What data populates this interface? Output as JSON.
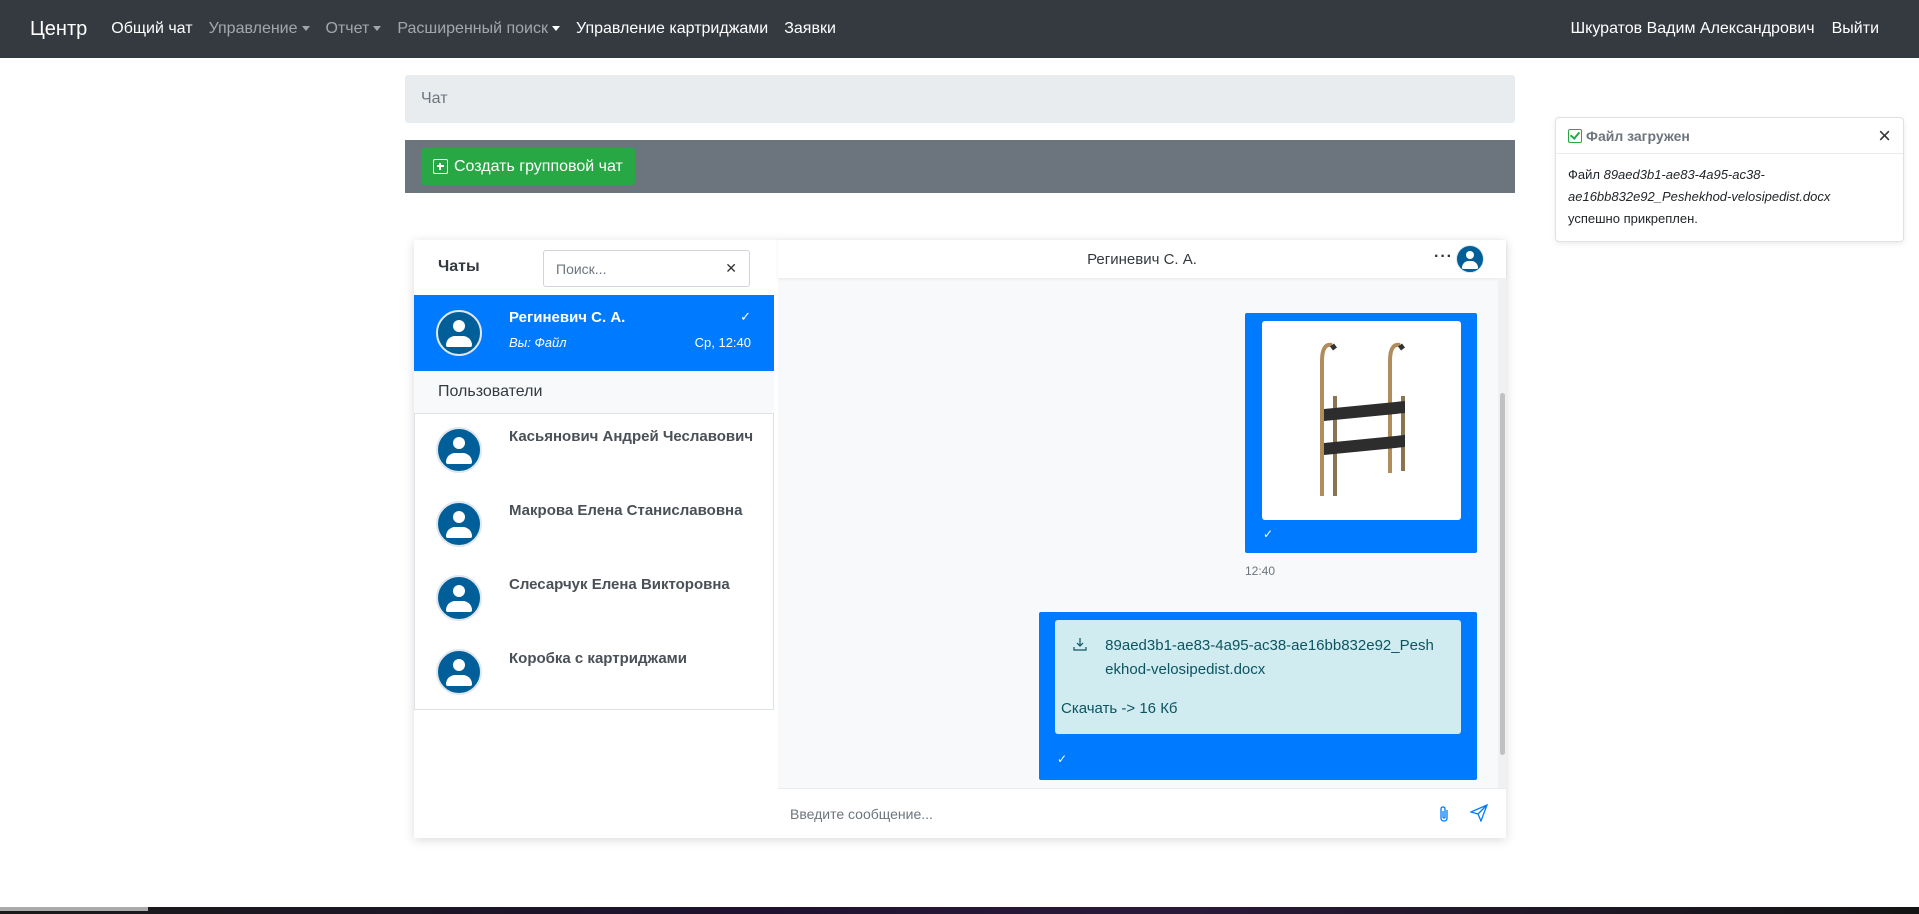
{
  "navbar": {
    "brand": "Центр",
    "links": [
      "Общий чат",
      "Управление",
      "Отчет",
      "Расширенный поиск",
      "Управление картриджами",
      "Заявки"
    ],
    "user_name": "Шкуратов Вадим Александрович",
    "logout": "Выйти"
  },
  "page": {
    "title": "Чат",
    "create_group_label": "Создать групповой чат"
  },
  "toast": {
    "title": "Файл загружен",
    "body_prefix": "Файл",
    "file_name": "89aed3b1-ae83-4a95-ac38-ae16bb832e92_Peshekhod-velosipedist.docx",
    "body_suffix": "успешно прикреплен."
  },
  "sidebar": {
    "chats_label": "Чаты",
    "search_placeholder": "Поиск...",
    "active_chat": {
      "name": "Региневич С. А.",
      "preview": "Вы: Файл",
      "time": "Ср, 12:40"
    },
    "users_label": "Пользователи",
    "users": [
      "Касьянович Андрей Чеславович",
      "Макрова Елена Станиславовна",
      "Слесарчук Елена Викторовна",
      "Коробка с картриджами"
    ]
  },
  "conversation": {
    "title": "Региневич С. А.",
    "image_time": "12:40",
    "file": {
      "name": "89aed3b1-ae83-4a95-ac38-ae16bb832e92_Peshekhod-velosipedist.docx",
      "download": "Скачать -> 16 Кб"
    },
    "composer_placeholder": "Введите сообщение..."
  },
  "colors": {
    "navbar": "#343a40",
    "primary": "#007bff",
    "success": "#28a745",
    "secondary": "#6c757d",
    "info_bg": "#d1ecf1"
  }
}
